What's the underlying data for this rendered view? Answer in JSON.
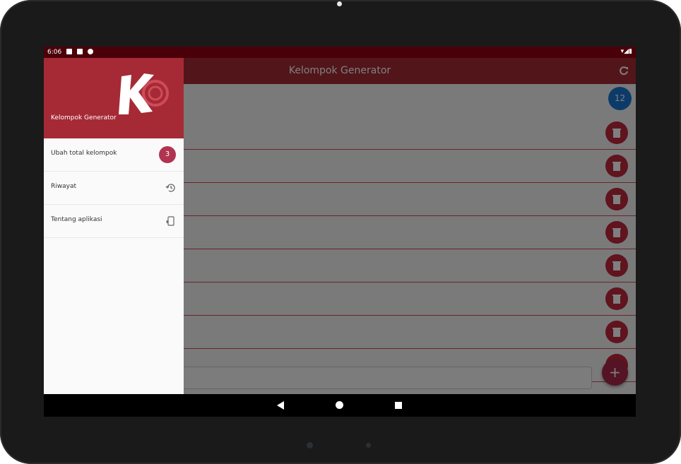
{
  "status_bar": {
    "time": "6:06"
  },
  "appbar": {
    "title": "Kelompok Generator",
    "refresh_icon": "refresh-icon"
  },
  "list": {
    "count_badge": "12",
    "row_count": 8
  },
  "input": {
    "placeholder": ""
  },
  "fab": {
    "label": "+"
  },
  "drawer": {
    "app_name": "Kelompok Generator",
    "items": [
      {
        "label": "Ubah total kelompok",
        "badge": "3"
      },
      {
        "label": "Riwayat",
        "icon": "history-icon"
      },
      {
        "label": "Tentang aplikasi",
        "icon": "phone-info-icon"
      }
    ]
  },
  "colors": {
    "primary": "#a52a35",
    "statusbar": "#4a0008",
    "delete": "#c0283c",
    "count_badge": "#1976d2",
    "fab": "#a8294a"
  }
}
